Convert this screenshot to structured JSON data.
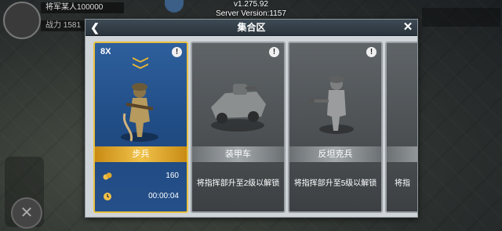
{
  "top": {
    "version": "v1.275.92",
    "server_version": "Server Version:1157",
    "player_name": "将军某人100000",
    "player_power": "战力 1581"
  },
  "panel": {
    "title": "集合区",
    "back_icon": "chevron-left-icon",
    "close_icon": "close-icon"
  },
  "cards": [
    {
      "name": "步兵",
      "count": "8X",
      "locked": false,
      "info_icon": "info-icon",
      "stats": [
        {
          "icon": "coins-icon",
          "value": "160"
        },
        {
          "icon": "clock-icon",
          "value": "00:00:04"
        }
      ]
    },
    {
      "name": "装甲车",
      "locked": true,
      "info_icon": "info-icon",
      "lock_text": "将指挥部升至2级以解锁"
    },
    {
      "name": "反坦克兵",
      "locked": true,
      "info_icon": "info-icon",
      "lock_text": "将指挥部升至5级以解锁"
    },
    {
      "name": "",
      "locked": true,
      "lock_text": "将指"
    }
  ],
  "colors": {
    "gold": "#e8c040",
    "unlocked_card": "#2e5f9c",
    "locked_card": "#5f6467",
    "header": "#2a333b"
  }
}
